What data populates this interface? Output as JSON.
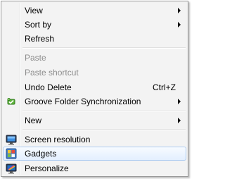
{
  "menu": {
    "view": "View",
    "sort_by": "Sort by",
    "refresh": "Refresh",
    "paste": "Paste",
    "paste_shortcut": "Paste shortcut",
    "undo_delete": "Undo Delete",
    "undo_delete_shortcut": "Ctrl+Z",
    "groove": "Groove Folder Synchronization",
    "new": "New",
    "screen_resolution": "Screen resolution",
    "gadgets": "Gadgets",
    "personalize": "Personalize"
  },
  "icons": {
    "groove": "groove-sync-icon",
    "screen_resolution": "monitor-icon",
    "gadgets": "gadgets-icon",
    "personalize": "personalize-icon"
  },
  "colors": {
    "menu_background": "#f3f3f3",
    "menu_border": "#979797",
    "disabled_text": "#8d8d8d",
    "hover_border": "#aeccf1",
    "hover_fill": "#e3efff"
  },
  "state": {
    "highlighted_item": "Gadgets",
    "disabled_items": [
      "Paste",
      "Paste shortcut"
    ]
  }
}
